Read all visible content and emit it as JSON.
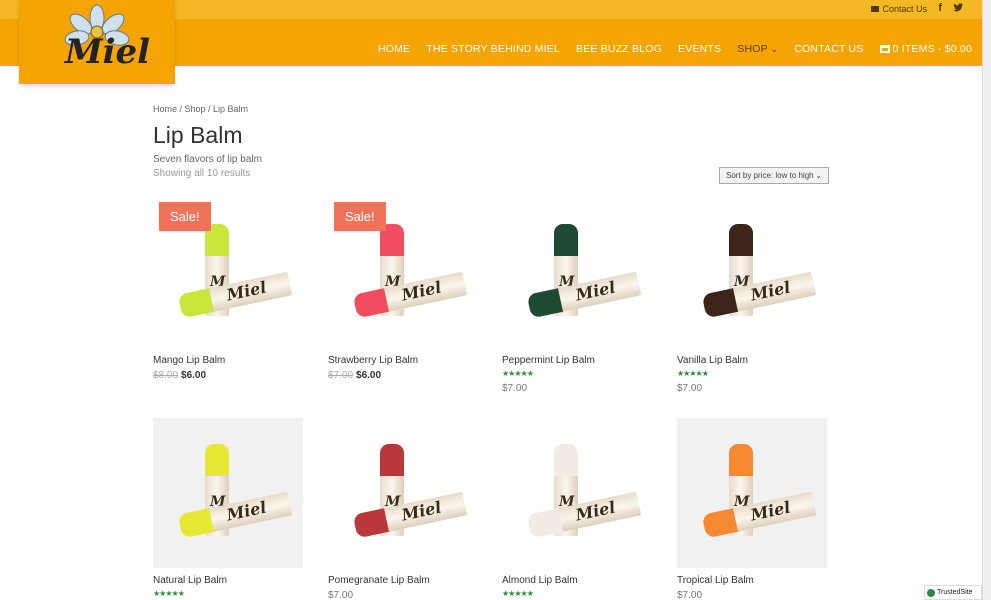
{
  "topbar": {
    "contact": "Contact Us",
    "facebook": "f"
  },
  "logo": {
    "word": "Miel"
  },
  "nav": {
    "items": [
      "HOME",
      "THE STORY BEHIND MIEL",
      "BEE BUZZ BLOG",
      "EVENTS",
      "SHOP",
      "CONTACT US"
    ],
    "cart": "0 ITEMS - $0.00"
  },
  "breadcrumb": "Home / Shop / Lip Balm",
  "page": {
    "title": "Lip Balm",
    "description": "Seven flavors of lip balm",
    "results": "Showing all 10 results",
    "sort": "Sort by price: low to high"
  },
  "stars": "★★★★★",
  "products": [
    {
      "name": "Mango Lip Balm",
      "sale": "Sale!",
      "old_price": "$8.00",
      "price": "$6.00",
      "color": "#c9e63a"
    },
    {
      "name": "Strawberry Lip Balm",
      "sale": "Sale!",
      "old_price": "$7.00",
      "price": "$6.00",
      "color": "#f04e5e"
    },
    {
      "name": "Peppermint Lip Balm",
      "price": "$7.00",
      "color": "#1e4a32"
    },
    {
      "name": "Vanilla Lip Balm",
      "price": "$7.00",
      "color": "#3d2418"
    },
    {
      "name": "Natural Lip Balm",
      "price": "",
      "color": "#e6e835"
    },
    {
      "name": "Pomegranate Lip Balm",
      "price": "$7.00",
      "color": "#b9383a"
    },
    {
      "name": "Almond Lip Balm",
      "price": "",
      "color": "#f3ece6"
    },
    {
      "name": "Tropical Lip Balm",
      "price": "$7.00",
      "color": "#f68a32"
    }
  ],
  "trusted": "TrustedSite"
}
